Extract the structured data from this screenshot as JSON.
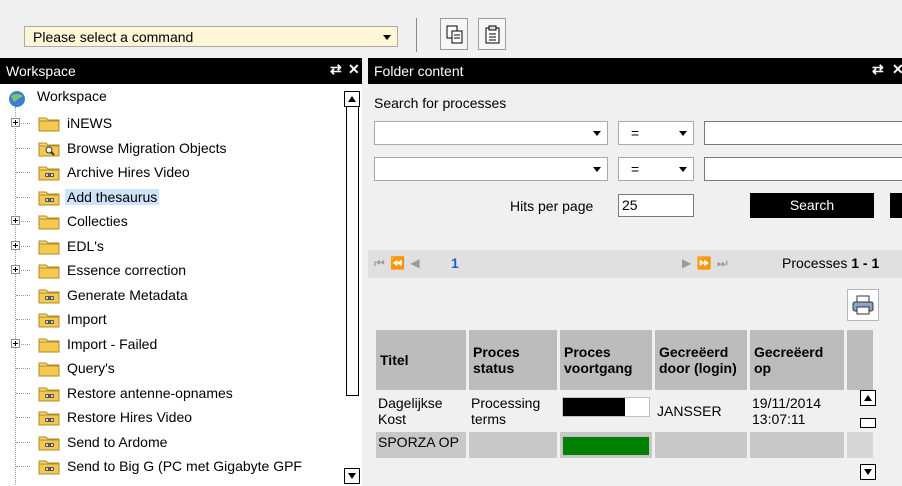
{
  "toolbar": {
    "command_select_value": "Please select a command",
    "copy_icon": "copy-icon",
    "paste_icon": "paste-icon"
  },
  "workspace_panel": {
    "title": "Workspace",
    "root_label": "Workspace",
    "items": [
      {
        "label": "iNEWS",
        "expandable": true,
        "icon": "folder"
      },
      {
        "label": "Browse Migration Objects",
        "expandable": false,
        "icon": "search-folder"
      },
      {
        "label": "Archive Hires Video",
        "expandable": false,
        "icon": "process-folder"
      },
      {
        "label": "Add thesaurus",
        "expandable": false,
        "icon": "process-folder",
        "selected": true
      },
      {
        "label": "Collecties",
        "expandable": true,
        "icon": "folder"
      },
      {
        "label": "EDL's",
        "expandable": true,
        "icon": "folder"
      },
      {
        "label": "Essence correction",
        "expandable": true,
        "icon": "folder"
      },
      {
        "label": "Generate Metadata",
        "expandable": false,
        "icon": "process-folder"
      },
      {
        "label": "Import",
        "expandable": false,
        "icon": "process-folder"
      },
      {
        "label": "Import - Failed",
        "expandable": true,
        "icon": "folder"
      },
      {
        "label": "Query's",
        "expandable": false,
        "icon": "folder"
      },
      {
        "label": "Restore antenne-opnames",
        "expandable": false,
        "icon": "process-folder"
      },
      {
        "label": "Restore Hires Video",
        "expandable": false,
        "icon": "process-folder"
      },
      {
        "label": "Send to Ardome",
        "expandable": false,
        "icon": "process-folder"
      },
      {
        "label": "Send to Big G (PC met Gigabyte GPF",
        "expandable": false,
        "icon": "process-folder"
      }
    ]
  },
  "folder_panel": {
    "title": "Folder content",
    "search_heading": "Search for processes",
    "filter_rows": [
      {
        "field": "",
        "operator": "=",
        "value": ""
      },
      {
        "field": "",
        "operator": "=",
        "value": ""
      }
    ],
    "hits_label": "Hits per page",
    "hits_value": "25",
    "search_button": "Search",
    "pager": {
      "current_page": "1",
      "summary_prefix": "Processes",
      "summary_range": "1 - 1"
    },
    "table": {
      "columns": [
        "Titel",
        "Proces status",
        "Proces voortgang",
        "Gecreëerd door (login)",
        "Gecreëerd op"
      ],
      "rows": [
        {
          "titel": "Dagelijkse Kost",
          "status": "Processing terms",
          "progress": 0.72,
          "progress_color": "#000000",
          "door": "JANSSER",
          "op": "19/11/2014 13:07:11"
        },
        {
          "titel": "SPORZA OP",
          "status": "",
          "progress": 1.0,
          "progress_color": "#008000",
          "door": "",
          "op": ""
        }
      ]
    }
  },
  "colors": {
    "header_bg": "#000000",
    "selection": "#cde3fb",
    "command_bg": "#fff6d8"
  }
}
